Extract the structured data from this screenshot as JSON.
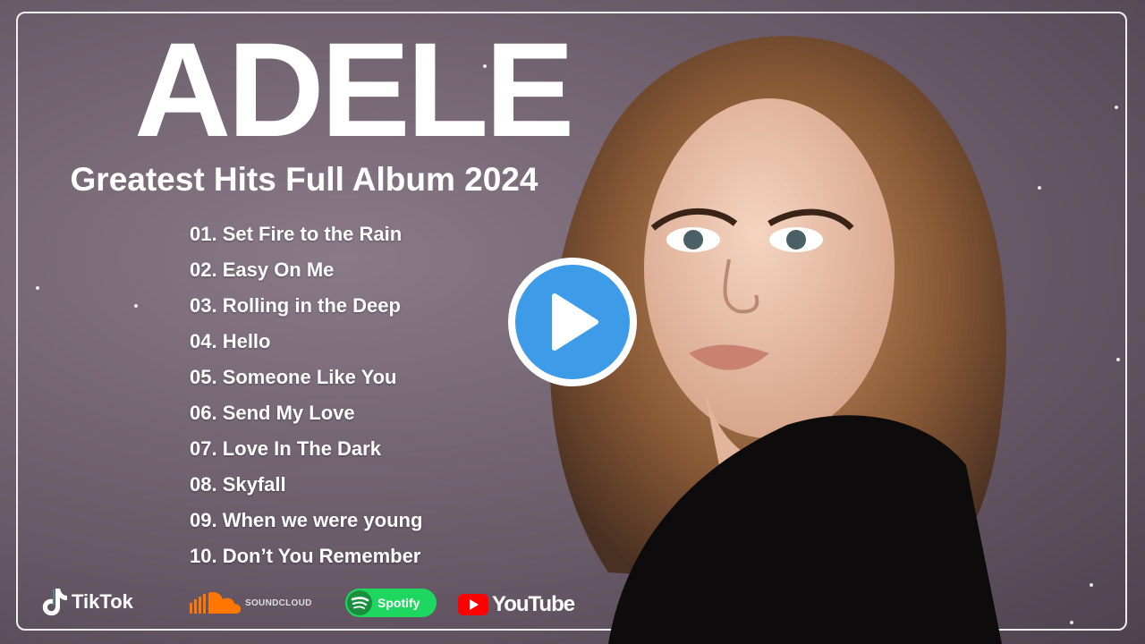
{
  "title": "ADELE",
  "subtitle": "Greatest Hits Full Album 2024",
  "tracks": [
    "01. Set Fire to the Rain",
    "02. Easy On Me",
    "03. Rolling in the Deep",
    "04. Hello",
    "05. Someone Like You",
    "06. Send My Love",
    "07. Love In The Dark",
    "08. Skyfall",
    "09. When we were young",
    "10. Don’t You Remember"
  ],
  "logos": {
    "tiktok": "TikTok",
    "soundcloud": "SOUNDCLOUD",
    "spotify": "Spotify",
    "youtube": "YouTube"
  },
  "colors": {
    "play_button": "#3d9be8",
    "spotify": "#1ed760",
    "youtube": "#ff0000"
  }
}
